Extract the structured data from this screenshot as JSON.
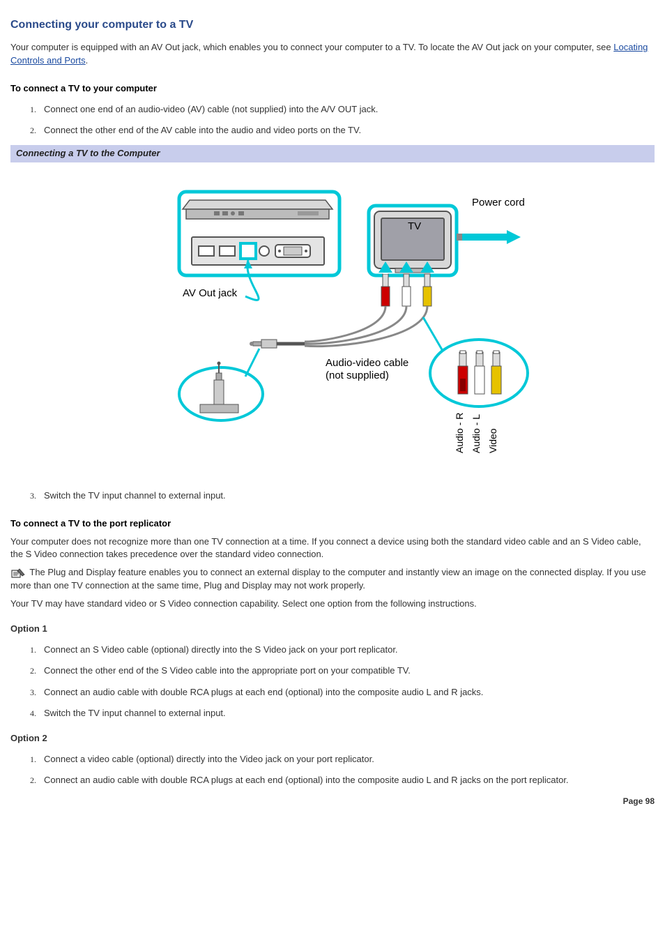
{
  "title": "Connecting your computer to a TV",
  "intro_text_part1": "Your computer is equipped with an AV Out jack, which enables you to connect your computer to a TV. To locate the AV Out jack on your computer, see ",
  "intro_link": "Locating Controls and Ports",
  "intro_text_part2": ".",
  "sub1": "To connect a TV to your computer",
  "steps_a": [
    "Connect one end of an audio-video (AV) cable (not supplied) into the A/V OUT jack.",
    "Connect the other end of the AV cable into the audio and video ports on the TV."
  ],
  "figure_caption": "Connecting a TV to the Computer",
  "figure_labels": {
    "tv": "TV",
    "power_cord": "Power cord",
    "av_out_jack": "AV Out jack",
    "av_cable_line1": "Audio-video cable",
    "av_cable_line2": "(not supplied)",
    "audio_r": "Audio - R",
    "audio_l": "Audio - L",
    "video": "Video"
  },
  "steps_b": [
    "Switch the TV input channel to external input."
  ],
  "sub2": "To connect a TV to the port replicator",
  "para2": "Your computer does not recognize more than one TV connection at a time. If you connect a device using both the standard video cable and an S Video cable, the S Video connection takes precedence over the standard video connection.",
  "note_text": " The Plug and Display feature enables you to connect an external display to the computer and instantly view an image on the connected display. If you use more than one TV connection at the same time, Plug and Display may not work properly.",
  "para3": "Your TV may have standard video or S Video connection capability. Select one option from the following instructions.",
  "option1_label": "Option 1",
  "option1_steps": [
    "Connect an S Video cable (optional) directly into the S Video jack on your port replicator.",
    "Connect the other end of the S Video cable into the appropriate port on your compatible TV.",
    "Connect an audio cable with double RCA plugs at each end (optional) into the composite audio L and R jacks.",
    "Switch the TV input channel to external input."
  ],
  "option2_label": "Option 2",
  "option2_steps": [
    "Connect a video cable (optional) directly into the Video jack on your port replicator.",
    "Connect an audio cable with double RCA plugs at each end (optional) into the composite audio L and R jacks on the port replicator."
  ],
  "page_number": "Page 98"
}
